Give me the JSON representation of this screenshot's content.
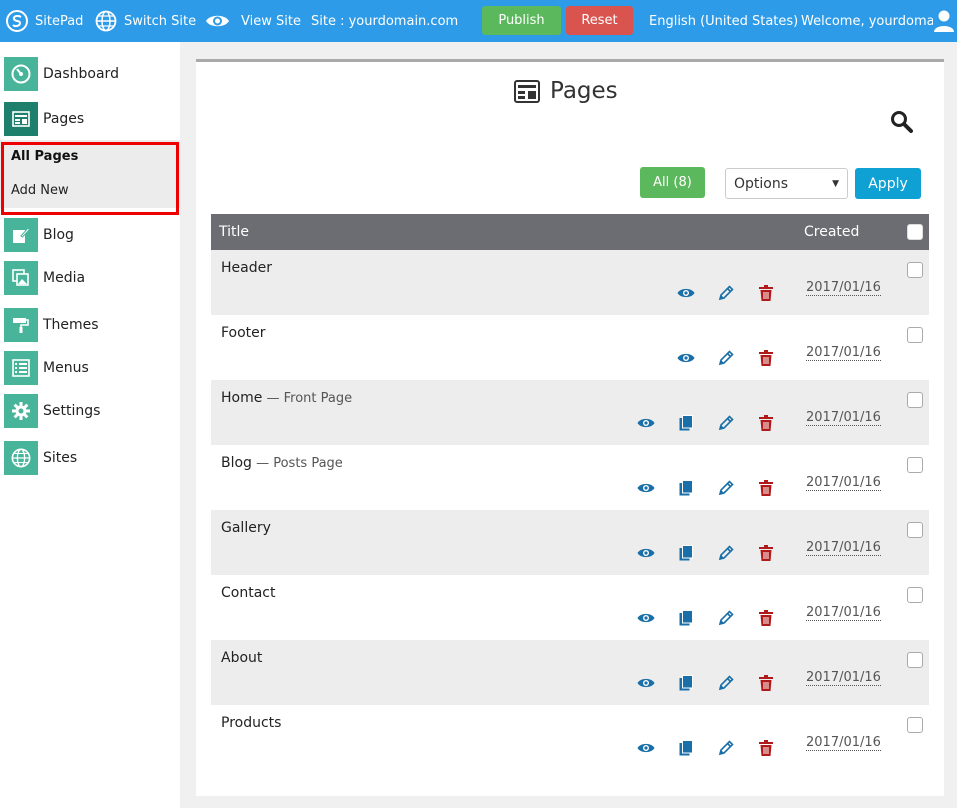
{
  "topbar": {
    "brand": "SitePad",
    "switch_site": "Switch Site",
    "view_site": "View Site",
    "site_label": "Site : yourdomain.com",
    "publish": "Publish",
    "reset": "Reset",
    "language": "English (United States)",
    "welcome": "Welcome, yourdoma"
  },
  "sidebar": {
    "items": [
      {
        "label": "Dashboard"
      },
      {
        "label": "Pages"
      },
      {
        "label": "Blog"
      },
      {
        "label": "Media"
      },
      {
        "label": "Themes"
      },
      {
        "label": "Menus"
      },
      {
        "label": "Settings"
      },
      {
        "label": "Sites"
      }
    ],
    "pages_sub": [
      "All Pages",
      "Add New"
    ]
  },
  "main": {
    "title": "Pages",
    "filter_all": "All (8)",
    "options": "Options",
    "apply": "Apply",
    "columns": {
      "title": "Title",
      "created": "Created"
    },
    "rows": [
      {
        "title": "Header",
        "suffix": "",
        "date": "2017/01/16",
        "copy": false
      },
      {
        "title": "Footer",
        "suffix": "",
        "date": "2017/01/16",
        "copy": false
      },
      {
        "title": "Home",
        "suffix": " — Front Page",
        "date": "2017/01/16",
        "copy": true
      },
      {
        "title": "Blog",
        "suffix": " — Posts Page",
        "date": "2017/01/16",
        "copy": true
      },
      {
        "title": "Gallery",
        "suffix": "",
        "date": "2017/01/16",
        "copy": true
      },
      {
        "title": "Contact",
        "suffix": "",
        "date": "2017/01/16",
        "copy": true
      },
      {
        "title": "About",
        "suffix": "",
        "date": "2017/01/16",
        "copy": true
      },
      {
        "title": "Products",
        "suffix": "",
        "date": "2017/01/16",
        "copy": true
      }
    ]
  },
  "colors": {
    "topbar": "#2d9be8",
    "accent_green": "#5cb85c",
    "danger": "#d9534f",
    "apply": "#10a1d4",
    "icon_blue": "#1a6fa8",
    "trash_red": "#b11a1a"
  }
}
